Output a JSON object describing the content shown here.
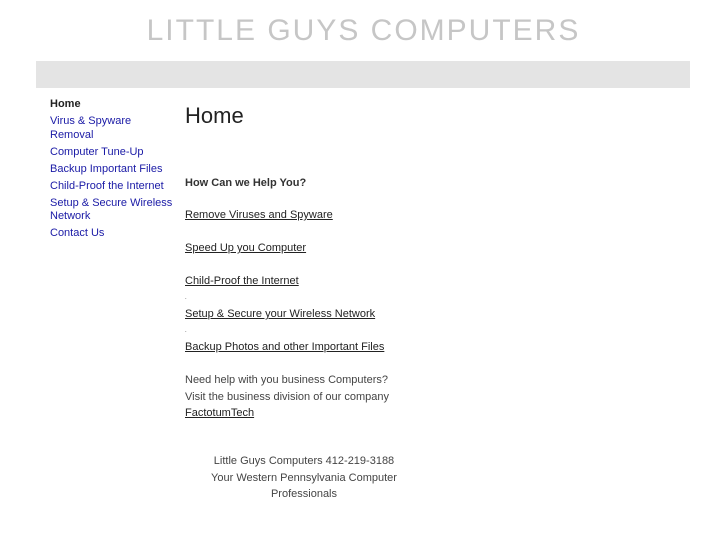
{
  "site": {
    "title": "LITTLE GUYS COMPUTERS"
  },
  "sidebar": {
    "items": [
      {
        "label": "Home",
        "current": true
      },
      {
        "label": "Virus & Spyware Removal"
      },
      {
        "label": "Computer Tune-Up"
      },
      {
        "label": "Backup Important Files"
      },
      {
        "label": "Child-Proof the Internet"
      },
      {
        "label": "Setup & Secure Wireless Network"
      },
      {
        "label": "Contact Us"
      }
    ]
  },
  "main": {
    "heading": "Home",
    "help_question": "How Can we Help You?",
    "services": [
      "Remove Viruses and Spyware",
      "Speed Up you Computer",
      "Child-Proof the Internet",
      "Setup & Secure your Wireless Network",
      "Backup Photos and other Important Files"
    ],
    "separator_dot": ".",
    "business": {
      "line1": "Need help with you business Computers?",
      "line2": "Visit the business division of our company",
      "link": "FactotumTech"
    }
  },
  "footer": {
    "line1": "Little Guys Computers 412-219-3188",
    "line2": "Your Western Pennsylvania Computer Professionals"
  }
}
